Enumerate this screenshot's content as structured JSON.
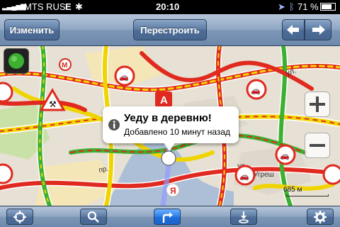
{
  "status_bar": {
    "carrier": "MTS RUS",
    "network": "E",
    "time": "20:10",
    "battery_percent": "71 %"
  },
  "nav_bar": {
    "edit_label": "Изменить",
    "rebuild_label": "Перестроить",
    "back_icon": "arrow-left-icon",
    "forward_icon": "arrow-right-icon"
  },
  "map": {
    "callout": {
      "title": "Уеду в деревню!",
      "subtitle": "Добавлено 10 минут назад"
    },
    "labels": {
      "street_ul": "ул.",
      "street_pr": "пр.",
      "street_ul2": "ул.",
      "ugresh": "Угреш",
      "marker_a": "А",
      "marker_ya": "Я",
      "metro": "М"
    },
    "scale_label": "685 м",
    "colors": {
      "jam_red": "#e02a20",
      "jam_yellow": "#f0d400",
      "free_green": "#3cb030",
      "water": "#9fb7d6",
      "park": "#c9e0a6"
    }
  },
  "toolbar": {
    "buttons": [
      {
        "icon": "location-icon",
        "active": false
      },
      {
        "icon": "search-icon",
        "active": false
      },
      {
        "icon": "route-icon",
        "active": true
      },
      {
        "icon": "pin-drop-icon",
        "active": false
      },
      {
        "icon": "settings-icon",
        "active": false
      }
    ]
  }
}
